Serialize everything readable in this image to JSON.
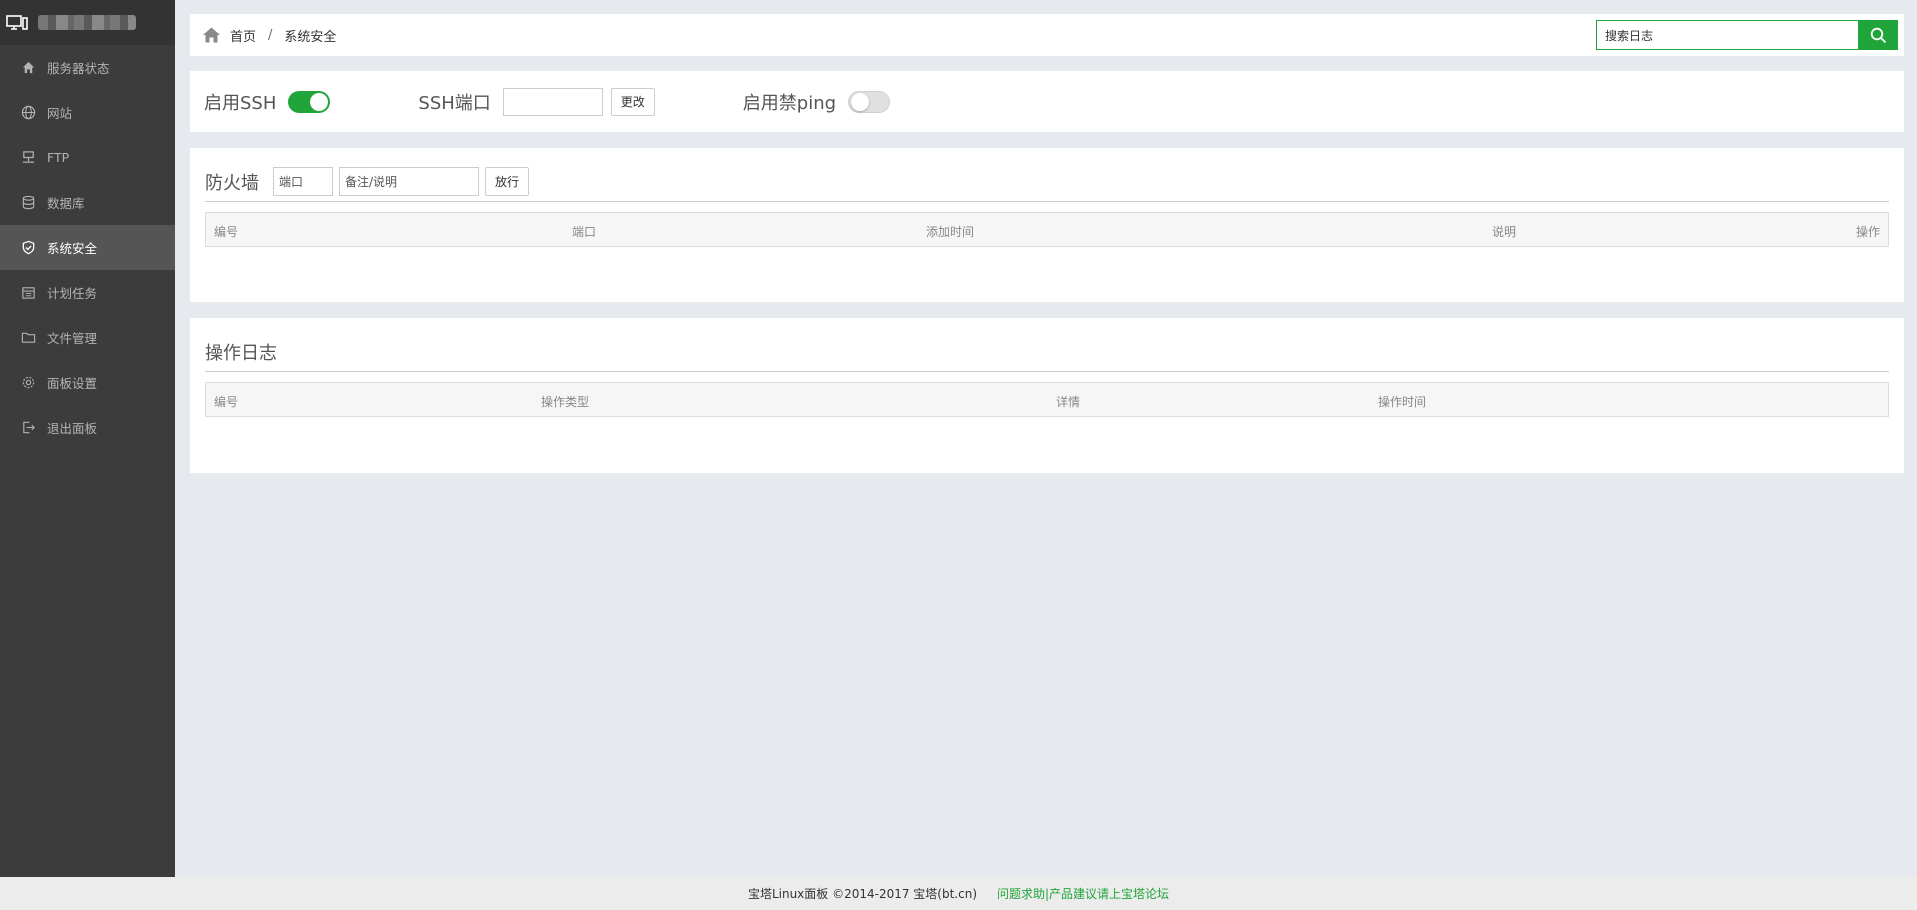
{
  "sidebar": {
    "items": [
      {
        "label": "服务器状态",
        "icon": "home-icon",
        "active": false
      },
      {
        "label": "网站",
        "icon": "globe-icon",
        "active": false
      },
      {
        "label": "FTP",
        "icon": "ftp-icon",
        "active": false
      },
      {
        "label": "数据库",
        "icon": "database-icon",
        "active": false
      },
      {
        "label": "系统安全",
        "icon": "shield-icon",
        "active": true
      },
      {
        "label": "计划任务",
        "icon": "calendar-icon",
        "active": false
      },
      {
        "label": "文件管理",
        "icon": "folder-icon",
        "active": false
      },
      {
        "label": "面板设置",
        "icon": "gear-icon",
        "active": false
      },
      {
        "label": "退出面板",
        "icon": "logout-icon",
        "active": false
      }
    ]
  },
  "breadcrumb": {
    "home": "首页",
    "sep": "/",
    "current": "系统安全"
  },
  "search": {
    "value": "搜索日志"
  },
  "ssh": {
    "enable_label": "启用SSH",
    "enabled": true,
    "port_label": "SSH端口",
    "port_value": "",
    "change_button": "更改",
    "ping_label": "启用禁ping",
    "ping_enabled": false
  },
  "firewall": {
    "title": "防火墙",
    "port_placeholder": "端口",
    "note_placeholder": "备注/说明",
    "allow_button": "放行",
    "columns": [
      "编号",
      "端口",
      "添加时间",
      "说明",
      "操作"
    ]
  },
  "oplog": {
    "title": "操作日志",
    "columns": [
      "编号",
      "操作类型",
      "详情",
      "操作时间"
    ]
  },
  "footer": {
    "copyright": "宝塔Linux面板 ©2014-2017 宝塔(bt.cn)",
    "link": "问题求助|产品建议请上宝塔论坛"
  },
  "colors": {
    "accent": "#20a53a",
    "sidebar_bg": "#3c3c3c",
    "sidebar_active": "#555555"
  }
}
